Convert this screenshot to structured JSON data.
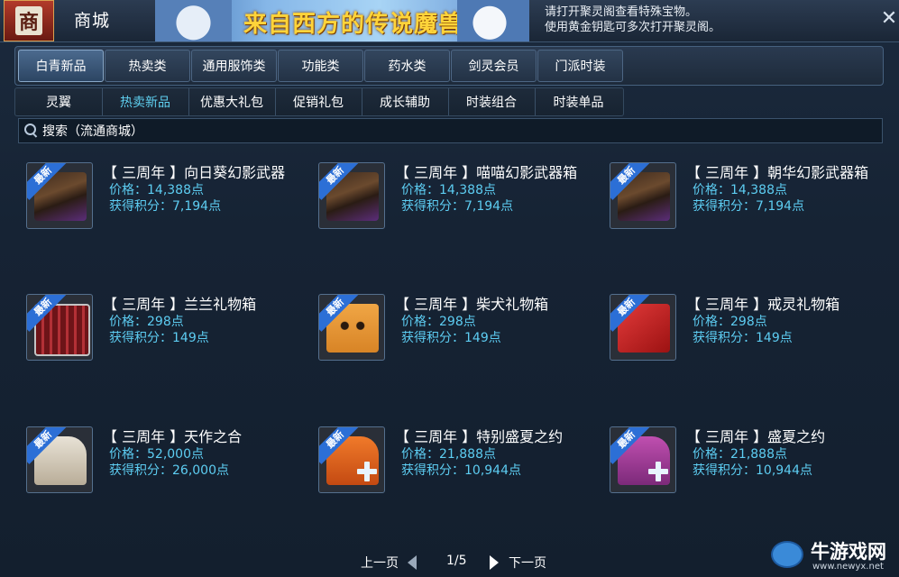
{
  "header": {
    "logo_char": "商",
    "title": "商城",
    "banner_text": "来自西方的传说魔兽",
    "hint_line1": "请打开聚灵阁查看特殊宝物。",
    "hint_line2": "使用黄金钥匙可多次打开聚灵阁。",
    "close_label": "✕"
  },
  "tabs": [
    {
      "label": "白青新品",
      "active": true
    },
    {
      "label": "热卖类"
    },
    {
      "label": "通用服饰类"
    },
    {
      "label": "功能类"
    },
    {
      "label": "药水类"
    },
    {
      "label": "剑灵会员"
    },
    {
      "label": "门派时装"
    }
  ],
  "subtabs": [
    {
      "label": "灵翼"
    },
    {
      "label": "热卖新品",
      "active": true
    },
    {
      "label": "优惠大礼包"
    },
    {
      "label": "促销礼包"
    },
    {
      "label": "成长辅助"
    },
    {
      "label": "时装组合"
    },
    {
      "label": "时装单品"
    }
  ],
  "search": {
    "placeholder": "搜索（流通商城）"
  },
  "items": [
    {
      "name": "【 三周年 】向日葵幻影武器",
      "price": "价格：14,388点",
      "points": "获得积分：7,194点",
      "badge": "最新",
      "icon": "weapon-chest-icon"
    },
    {
      "name": "【 三周年 】喵喵幻影武器箱",
      "price": "价格：14,388点",
      "points": "获得积分：7,194点",
      "badge": "最新",
      "icon": "weapon-chest-icon"
    },
    {
      "name": "【 三周年 】朝华幻影武器箱",
      "price": "价格：14,388点",
      "points": "获得积分：7,194点",
      "badge": "最新",
      "icon": "weapon-chest-icon"
    },
    {
      "name": "【 三周年 】兰兰礼物箱",
      "price": "价格：298点",
      "points": "获得积分：149点",
      "badge": "最新",
      "icon": "gift-box-icon"
    },
    {
      "name": "【 三周年 】柴犬礼物箱",
      "price": "价格：298点",
      "points": "获得积分：149点",
      "badge": "最新",
      "icon": "shiba-box-icon"
    },
    {
      "name": "【 三周年 】戒灵礼物箱",
      "price": "价格：298点",
      "points": "获得积分：149点",
      "badge": "最新",
      "icon": "red-gift-box-icon"
    },
    {
      "name": "【 三周年 】天作之合",
      "price": "价格：52,000点",
      "points": "获得积分：26,000点",
      "badge": "最新",
      "icon": "white-outfit-icon"
    },
    {
      "name": "【 三周年 】特别盛夏之约",
      "price": "价格：21,888点",
      "points": "获得积分：10,944点",
      "badge": "最新",
      "icon": "orange-outfit-icon"
    },
    {
      "name": "【 三周年 】盛夏之约",
      "price": "价格：21,888点",
      "points": "获得积分：10,944点",
      "badge": "最新",
      "icon": "purple-outfit-icon"
    }
  ],
  "pager": {
    "prev": "上一页",
    "page": "1/5",
    "next": "下一页"
  },
  "watermark": {
    "name": "牛游戏网",
    "url": "www.newyx.net"
  },
  "colors": {
    "accent_price": "#5dcdf2",
    "badge": "#2c6fd6",
    "active_subtab": "#5fd0f0"
  }
}
